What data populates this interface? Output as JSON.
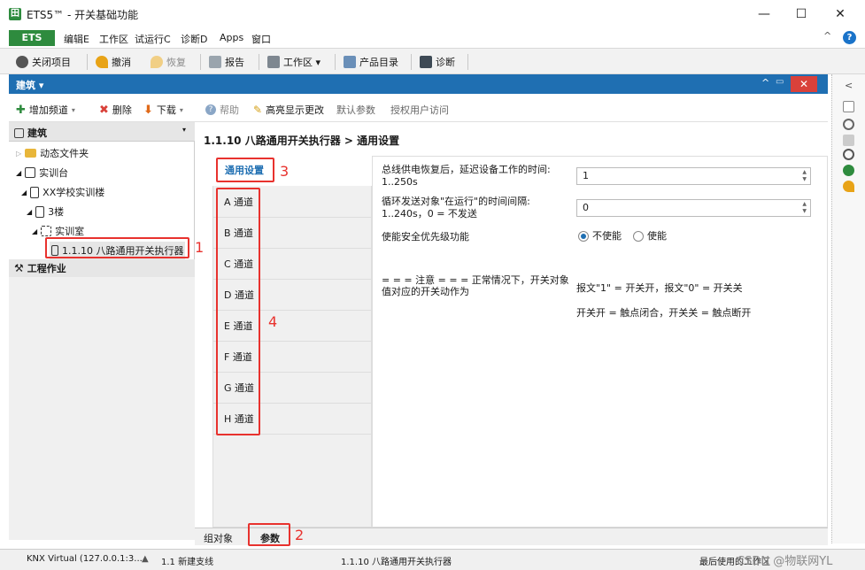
{
  "window": {
    "title": "ETS5™ - 开关基础功能",
    "app_icon": "田",
    "minimize": "—",
    "maximize": "☐",
    "close": "✕"
  },
  "menu": {
    "ets": "ETS",
    "items": [
      "编辑E",
      "工作区",
      "试运行C",
      "诊断D",
      "Apps",
      "窗口"
    ],
    "help": "?",
    "collapse": "^"
  },
  "toolbar": {
    "close_project": "关闭项目",
    "undo": "撤消",
    "redo": "恢复",
    "report": "报告",
    "workspace": "工作区 ▾",
    "catalog": "产品目录",
    "diagnostics": "诊断"
  },
  "panel": {
    "title": "建筑 ▾",
    "up": "^",
    "restore": "▭",
    "close": "✕"
  },
  "actions": {
    "add_channel": "增加频道",
    "delete": "删除",
    "download": "下载",
    "help": "帮助",
    "highlight": "高亮显示更改",
    "default_params": "默认参数",
    "authorize": "授权用户访问"
  },
  "tree": {
    "header": "建筑",
    "items": [
      {
        "label": "动态文件夹"
      },
      {
        "label": "实训台"
      },
      {
        "label": "XX学校实训楼"
      },
      {
        "label": "3楼"
      },
      {
        "label": "实训室"
      },
      {
        "label": "1.1.10 八路通用开关执行器"
      }
    ],
    "ops": "工程作业"
  },
  "content": {
    "breadcrumb": "1.1.10 八路通用开关执行器 > 通用设置",
    "active_tab": "通用设置",
    "channels": [
      "A 通道",
      "B 通道",
      "C 通道",
      "D 通道",
      "E 通道",
      "F 通道",
      "G 通道",
      "H 通道"
    ]
  },
  "params": {
    "p1_label": "总线供电恢复后，延迟设备工作的时间:",
    "p1_range": "1..250s",
    "p1_value": "1",
    "p2_label": "循环发送对象\"在运行\"的时间间隔:",
    "p2_range": "1..240s，0 = 不发送",
    "p2_value": "0",
    "p3_label": "使能安全优先级功能",
    "p3_option_off": "不使能",
    "p3_option_on": "使能",
    "note_left": "= = = 注意 = = = 正常情况下，开关对象值对应的开关动作为",
    "note_right1": "报文\"1\" = 开关开，报文\"0\" = 开关关",
    "note_right2": "开关开 = 触点闭合，开关关 = 触点断开"
  },
  "bottom_tabs": {
    "group_objects": "组对象",
    "parameters": "参数"
  },
  "status": {
    "connection": "KNX Virtual  (127.0.0.1:3...",
    "line": "1.1 新建支线",
    "device": "1.1.10 八路通用开关执行器",
    "last_used": "最后使用的工作区",
    "watermark": "CSDN @物联网YL"
  },
  "annotations": [
    "1",
    "2",
    "3",
    "4"
  ],
  "colors": {
    "brand_green": "#2e8b3e",
    "panel_blue": "#1f6fb2",
    "annotation_red": "#e8322e"
  }
}
